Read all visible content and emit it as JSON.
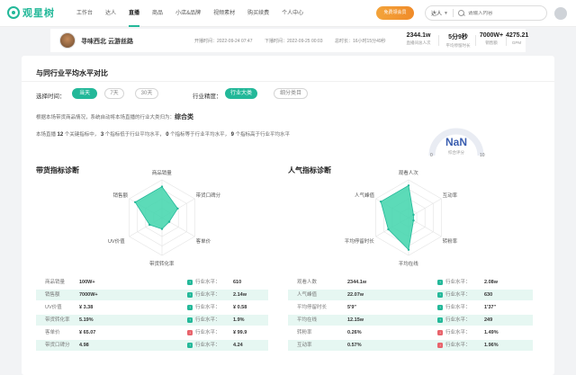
{
  "brand": {
    "name": "观星树"
  },
  "nav": {
    "items": [
      "工作台",
      "达人",
      "直播",
      "商品",
      "小店&品牌",
      "视频素材",
      "购买续费",
      "个人中心"
    ],
    "active_index": 2
  },
  "vip_button": "免费领会员",
  "search": {
    "scope": "达人",
    "placeholder": "请输入内容"
  },
  "room": {
    "name": "寻味西北 云游丝路",
    "start_label": "开播时间：2022-09-24 07:47",
    "end_label": "下播时间：2022-09-25 00:03",
    "duration_label": "总时长：16小时15分49秒",
    "kpis": [
      {
        "value": "2344.1w",
        "label": "直播间总人次"
      },
      {
        "value": "5分9秒",
        "label": "平均停留时长"
      },
      {
        "value": "7000W+",
        "label": "销售额"
      },
      {
        "value": "4275.21",
        "label": "GPM"
      }
    ]
  },
  "compare": {
    "title": "与同行业平均水平对比",
    "time_label": "选择时间：",
    "time_options": [
      "当天",
      "7天",
      "30天"
    ],
    "time_active": 0,
    "industry_label": "行业精度：",
    "industry_options": [
      "行业大类",
      "细分类目"
    ],
    "industry_active": 0,
    "desc_prefix": "根据本场带货商品情况，系统自动将本场直播的行业大类归为：",
    "industry_name": "综合类",
    "summary_1": "本场直播",
    "summary_count": "12",
    "summary_2": "个关键指标中，",
    "summary_a": "3",
    "summary_a_txt": "个指标低于行业平均水平，",
    "summary_b": "0",
    "summary_b_txt": "个指标等于行业平均水平，",
    "summary_c": "9",
    "summary_c_txt": "个指标高于行业平均水平",
    "gauge": {
      "value": "NaN",
      "label": "综合评分",
      "min": "0",
      "max": "10"
    }
  },
  "sales": {
    "title": "带货指标诊断",
    "radar_labels": [
      "商品销量",
      "带货口碑分",
      "客单价",
      "带货转化率",
      "UV价值",
      "销售额"
    ],
    "radar_values": [
      0.82,
      0.48,
      0.22,
      0.3,
      0.38,
      0.82
    ],
    "industry_prefix": "行业水平：",
    "rows": [
      {
        "name": "商品销量",
        "value": "100W+",
        "icon": "up",
        "industry": "610"
      },
      {
        "name": "销售额",
        "value": "7000W+",
        "icon": "up",
        "industry": "2.14w"
      },
      {
        "name": "UV价值",
        "value": "¥ 3.38",
        "icon": "up",
        "industry": "¥ 0.58"
      },
      {
        "name": "带货转化率",
        "value": "5.19%",
        "icon": "up",
        "industry": "1.9%"
      },
      {
        "name": "客单价",
        "value": "¥ 65.07",
        "icon": "down",
        "industry": "¥ 99.9"
      },
      {
        "name": "带货口碑分",
        "value": "4.98",
        "icon": "up",
        "industry": "4.24"
      }
    ]
  },
  "popularity": {
    "title": "人气指标诊断",
    "radar_labels": [
      "观看人次",
      "互动率",
      "转粉率",
      "平均在线",
      "平均停留时长",
      "人气峰值"
    ],
    "radar_values": [
      0.85,
      0.15,
      0.15,
      0.85,
      0.62,
      0.85
    ],
    "industry_prefix": "行业水平：",
    "rows": [
      {
        "name": "观看人数",
        "value": "2344.1w",
        "icon": "up",
        "industry": "2.08w"
      },
      {
        "name": "人气峰值",
        "value": "22.07w",
        "icon": "up",
        "industry": "630"
      },
      {
        "name": "平均停留时长",
        "value": "5'9\"",
        "icon": "up",
        "industry": "1'37\""
      },
      {
        "name": "平均在线",
        "value": "12.15w",
        "icon": "up",
        "industry": "249"
      },
      {
        "name": "转粉率",
        "value": "0.26%",
        "icon": "down",
        "industry": "1.49%"
      },
      {
        "name": "互动率",
        "value": "0.57%",
        "icon": "down",
        "industry": "1.96%"
      }
    ]
  },
  "colors": {
    "accent": "#23b899",
    "down": "#e8636b",
    "radar_fill": "#3fd5ac",
    "gauge": "#3a5eb0"
  }
}
